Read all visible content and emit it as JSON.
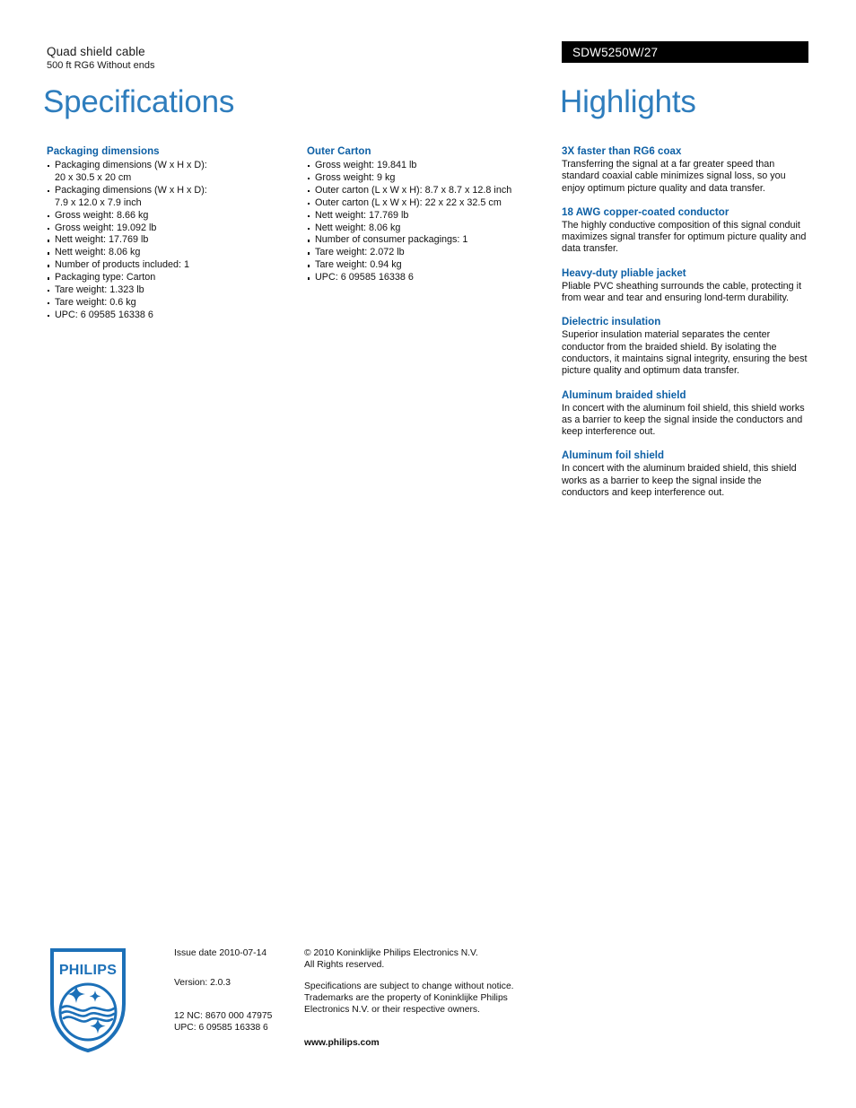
{
  "header": {
    "product_title": "Quad shield cable",
    "product_subtitle": "500 ft RG6 Without ends",
    "model_number": "SDW5250W/27",
    "left_heading": "Specifications",
    "right_heading": "Highlights",
    "accent_color": "#2E7DBD",
    "section_heading_color": "#0C5FA5",
    "model_bar_color": "#000000"
  },
  "specifications": [
    {
      "title": "Packaging dimensions",
      "items": [
        {
          "text": "Packaging dimensions (W x H x D):",
          "cont": "20 x 30.5 x 20 cm"
        },
        {
          "text": "Packaging dimensions (W x H x D):",
          "cont": "7.9 x 12.0 x 7.9 inch"
        },
        {
          "text": "Gross weight: 8.66 kg"
        },
        {
          "text": "Gross weight: 19.092 lb"
        },
        {
          "text": "Nett weight: 17.769 lb"
        },
        {
          "text": "Nett weight: 8.06 kg"
        },
        {
          "text": "Number of products included: 1"
        },
        {
          "text": "Packaging type: Carton"
        },
        {
          "text": "Tare weight: 1.323 lb"
        },
        {
          "text": "Tare weight: 0.6 kg"
        },
        {
          "text": "UPC: 6 09585 16338 6"
        }
      ]
    },
    {
      "title": "Outer Carton",
      "items": [
        {
          "text": "Gross weight: 19.841 lb"
        },
        {
          "text": "Gross weight: 9 kg"
        },
        {
          "text": "Outer carton (L x W x H): 8.7 x 8.7 x 12.8 inch"
        },
        {
          "text": "Outer carton (L x W x H): 22 x 22 x 32.5 cm"
        },
        {
          "text": "Nett weight: 17.769 lb"
        },
        {
          "text": "Nett weight: 8.06 kg"
        },
        {
          "text": "Number of consumer packagings: 1"
        },
        {
          "text": "Tare weight: 2.072 lb"
        },
        {
          "text": "Tare weight: 0.94 kg"
        },
        {
          "text": "UPC: 6 09585 16338 6"
        }
      ]
    }
  ],
  "highlights": [
    {
      "title": "3X faster than RG6 coax",
      "body": "Transferring the signal at a far greater speed than standard coaxial cable minimizes signal loss, so you enjoy optimum picture quality and data transfer."
    },
    {
      "title": "18 AWG copper-coated conductor",
      "body": "The highly conductive composition of this signal conduit maximizes signal transfer for optimum picture quality and data transfer."
    },
    {
      "title": "Heavy-duty pliable jacket",
      "body": "Pliable PVC sheathing surrounds the cable, protecting it from wear and tear and ensuring lond-term durability."
    },
    {
      "title": "Dielectric insulation",
      "body": "Superior insulation material separates the center conductor from the braided shield. By isolating the conductors, it maintains signal integrity, ensuring the best picture quality and optimum data transfer."
    },
    {
      "title": "Aluminum braided shield",
      "body": "In concert with the aluminum foil shield, this shield works as a barrier to keep the signal inside the conductors and keep interference out."
    },
    {
      "title": "Aluminum foil shield",
      "body": "In concert with the aluminum braided shield, this shield works as a barrier to keep the signal inside the conductors and keep interference out."
    }
  ],
  "footer": {
    "logo_text": "PHILIPS",
    "logo_color": "#1C70B8",
    "issue_date": "Issue date 2010-07-14",
    "version": "Version: 2.0.3",
    "twelve_nc": "12 NC: 8670 000 47975",
    "upc": "UPC: 6 09585 16338 6",
    "copyright_line1": "© 2010 Koninklijke Philips Electronics N.V.",
    "copyright_line2": "All Rights reserved.",
    "disclaimer_line1": "Specifications are subject to change without notice.",
    "disclaimer_line2": "Trademarks are the property of Koninklijke Philips",
    "disclaimer_line3": "Electronics N.V. or their respective owners.",
    "website": "www.philips.com"
  }
}
